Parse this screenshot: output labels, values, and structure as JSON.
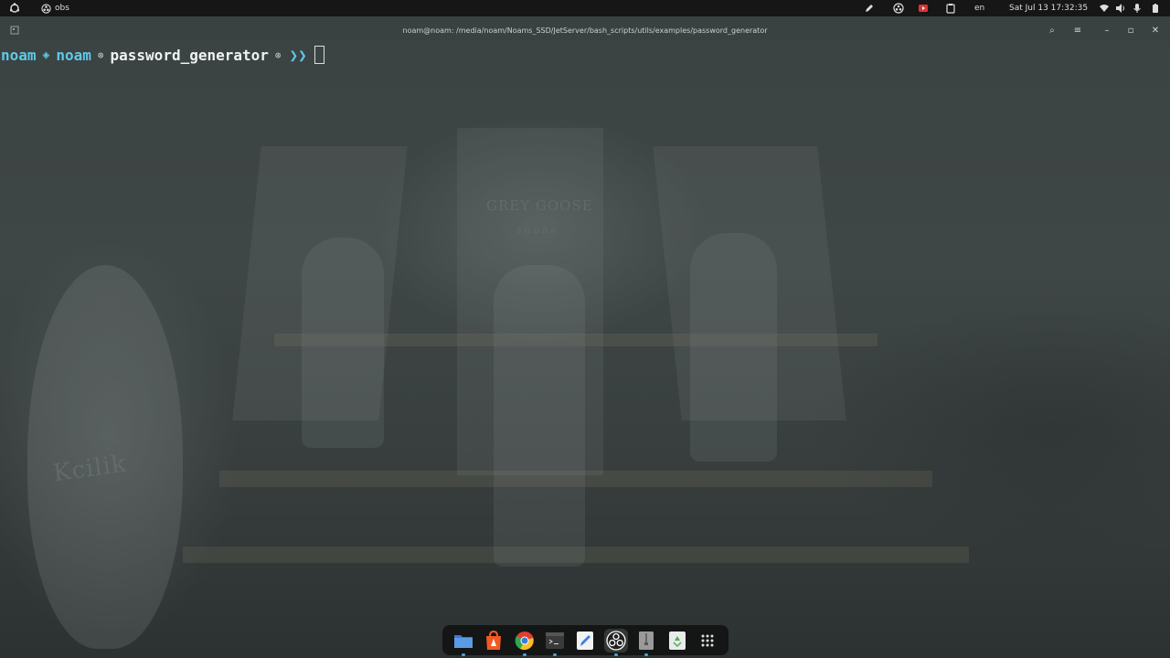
{
  "topbar": {
    "app_name": "obs",
    "language": "en",
    "datetime": "Sat Jul 13  17:32:35"
  },
  "window": {
    "title": "noam@noam: /media/noam/Noams_SSD/JetServer/bash_scripts/utils/examples/password_generator",
    "min_symbol": "–",
    "max_symbol": "▫",
    "close_symbol": "✕",
    "search_symbol": "⌕",
    "menu_symbol": "≡"
  },
  "terminal": {
    "user": "noam",
    "sep_glyph": "◈",
    "host": "noam",
    "dot_glyph": "⊛",
    "directory": "password_generator",
    "dot_glyph2": "⊛",
    "arrow_glyph": "❯❯"
  },
  "wallpaper": {
    "brand_1": "GREY GOOSE",
    "brand_2": "SHORA",
    "brand_3": "Kcilik"
  },
  "dock": {
    "items": [
      {
        "name": "files-icon",
        "color": "#3a7ad0"
      },
      {
        "name": "app-center-icon",
        "color": "#f05a22"
      },
      {
        "name": "chrome-icon",
        "color": "#e0402f"
      },
      {
        "name": "terminal-icon",
        "color": "#2c2c2c"
      },
      {
        "name": "text-editor-icon",
        "color": "#3f7fe0"
      },
      {
        "name": "obs-icon",
        "color": "#ffffff"
      },
      {
        "name": "archive-icon",
        "color": "#9a9a9a"
      },
      {
        "name": "trash-icon",
        "color": "#4caf50"
      },
      {
        "name": "show-apps-icon",
        "color": "#dddddd"
      }
    ]
  }
}
